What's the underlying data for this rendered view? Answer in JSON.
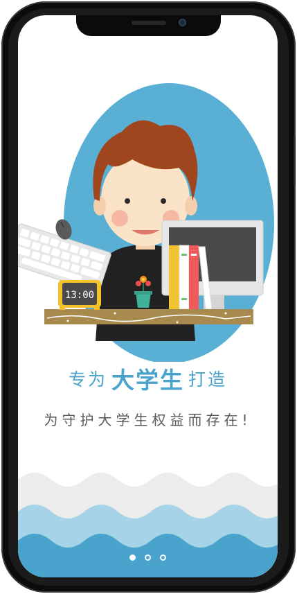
{
  "onboarding": {
    "headline_prefix": "专为",
    "headline_highlight": "大学生",
    "headline_suffix": "打造",
    "subtitle": "为守护大学生权益而存在!",
    "page_indicator": {
      "current": 1,
      "total": 3
    },
    "clock_time": "13:00"
  },
  "colors": {
    "accent_blue": "#4aa3cc",
    "hair": "#a0461e",
    "skin": "#fbe3c8",
    "wave_light": "#9fd0e6",
    "wave_dark": "#4aa3cc"
  },
  "icons": [
    "keyboard-icon",
    "mouse-icon",
    "clock-icon",
    "flower-pot-icon",
    "book-icon",
    "monitor-icon"
  ]
}
